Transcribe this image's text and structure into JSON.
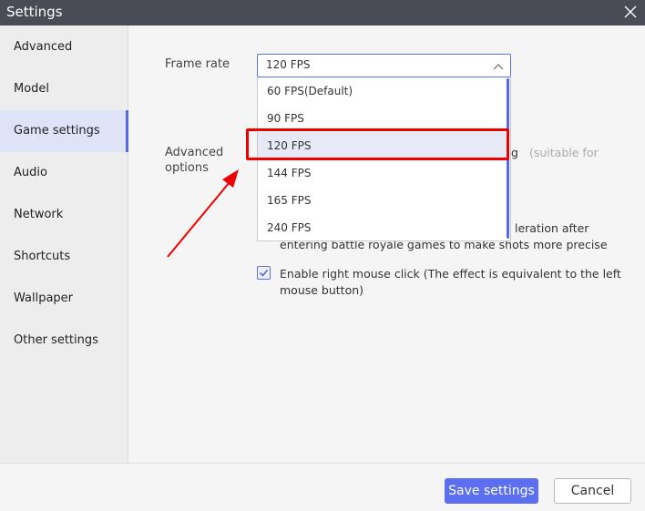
{
  "window": {
    "title": "Settings"
  },
  "sidebar": {
    "items": [
      {
        "label": "Advanced",
        "active": false
      },
      {
        "label": "Model",
        "active": false
      },
      {
        "label": "Game settings",
        "active": true
      },
      {
        "label": "Audio",
        "active": false
      },
      {
        "label": "Network",
        "active": false
      },
      {
        "label": "Shortcuts",
        "active": false
      },
      {
        "label": "Wallpaper",
        "active": false
      },
      {
        "label": "Other settings",
        "active": false
      }
    ]
  },
  "game_settings": {
    "frame_rate_label": "Frame rate",
    "frame_rate_value": "120 FPS",
    "frame_rate_options": [
      "60  FPS(Default)",
      "90 FPS",
      "120 FPS",
      "144 FPS",
      "165 FPS",
      "240 FPS"
    ],
    "frame_rate_selected": "120 FPS",
    "advanced_options_label_line1": "Advanced",
    "advanced_options_label_line2": "options",
    "partial_option_tail": "g",
    "partial_option_hint": "(suitable for",
    "mouse_accel_line1_tail": "leration after",
    "mouse_accel_line2": "entering battle royale games to make shots more precise",
    "right_click_line1": "Enable right mouse click (The effect is equivalent to the left",
    "right_click_line2": "mouse button)",
    "right_click_checked": true
  },
  "footer": {
    "save_label": "Save settings",
    "cancel_label": "Cancel"
  },
  "colors": {
    "accent": "#5b6ff0",
    "highlight": "#e00000",
    "titlebar": "#494b55"
  }
}
